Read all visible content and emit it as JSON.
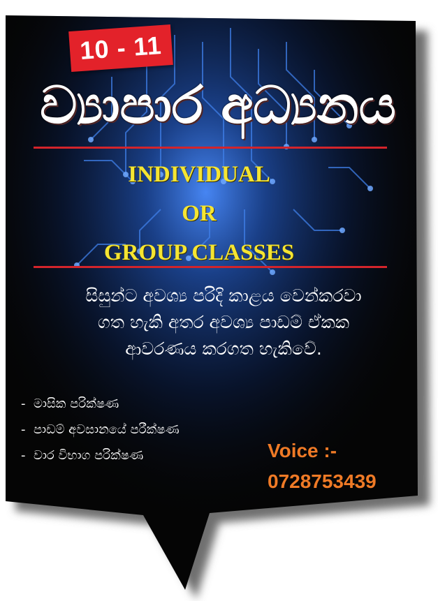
{
  "badge": {
    "grade_range": "10 - 11"
  },
  "headline": "ව්‍යාපාර අධ්‍යනය",
  "class_types": {
    "line1": "INDIVIDUAL",
    "line2": "OR",
    "line3": "GROUP CLASSES"
  },
  "description": {
    "line1": "සිසුන්ට අවශ්‍ය පරිදි කාළය වෙන්කරවා",
    "line2": "ගත හැකි අතර අවශ්‍ය පාඩම් ඒකක",
    "line3": "ආවරණය කරගත හැකිවේ."
  },
  "exams": [
    {
      "dash": "-",
      "label": "මාසික පරික්ෂණ"
    },
    {
      "dash": "-",
      "label": "පාඩම් අවසානයේ පරීක්ෂණ"
    },
    {
      "dash": "-",
      "label": "වාර විභාග පරික්ෂණ"
    }
  ],
  "contact": {
    "label": "Voice :-",
    "phone": "0728753439"
  },
  "colors": {
    "bubble_background": "#050505",
    "accent_red": "#e3222a",
    "class_text_yellow": "#f5e532",
    "contact_orange": "#ef7a26",
    "circuit_glow": "#2a6bd8"
  }
}
